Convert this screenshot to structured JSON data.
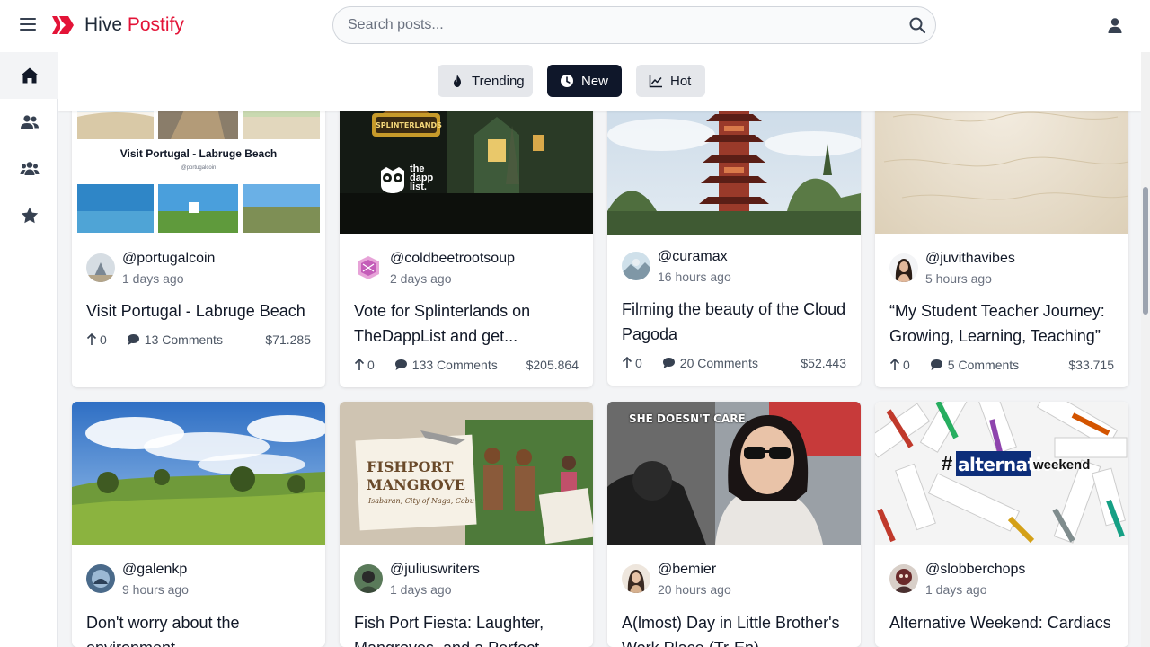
{
  "app": {
    "name_part1": "Hive",
    "name_part2": "Postify",
    "brand_color": "#e31337"
  },
  "search": {
    "placeholder": "Search posts..."
  },
  "filters": [
    {
      "label": "Trending",
      "icon": "flame-icon",
      "active": false
    },
    {
      "label": "New",
      "icon": "clock-icon",
      "active": true
    },
    {
      "label": "Hot",
      "icon": "chart-line-icon",
      "active": false
    }
  ],
  "sidebar": {
    "items": [
      {
        "icon": "home-icon",
        "active": true
      },
      {
        "icon": "users-icon",
        "active": false
      },
      {
        "icon": "communities-icon",
        "active": false
      },
      {
        "icon": "star-icon",
        "active": false
      }
    ]
  },
  "posts": [
    {
      "author": "@portugalcoin",
      "time": "1 days ago",
      "title": "Visit Portugal - Labruge Beach",
      "votes": "0",
      "comments": "13 Comments",
      "payout": "$71.285",
      "thumb_caption": "Visit Portugal - Labruge Beach",
      "thumb_subcaption": "@portugalcoin"
    },
    {
      "author": "@coldbeetrootsoup",
      "time": "2 days ago",
      "title": "Vote for Splinterlands on TheDappList and get...",
      "votes": "0",
      "comments": "133 Comments",
      "payout": "$205.864",
      "thumb_brand": "SPLINTERLANDS",
      "thumb_logo_line1": "the",
      "thumb_logo_line2": "dapp",
      "thumb_logo_line3": "list."
    },
    {
      "author": "@curamax",
      "time": "16 hours ago",
      "title": "Filming the beauty of the Cloud Pagoda",
      "votes": "0",
      "comments": "20 Comments",
      "payout": "$52.443"
    },
    {
      "author": "@juvithavibes",
      "time": "5 hours ago",
      "title": "“My Student Teacher Journey: Growing, Learning, Teaching”",
      "votes": "0",
      "comments": "5 Comments",
      "payout": "$33.715"
    },
    {
      "author": "@galenkp",
      "time": "9 hours ago",
      "title": "Don't worry about the environment"
    },
    {
      "author": "@juliuswriters",
      "time": "1 days ago",
      "title": "Fish Port Fiesta: Laughter, Mangroves, and a Perfect...",
      "thumb_line1": "FISHPORT",
      "thumb_line2": "MANGROVE",
      "thumb_line3": "Isabaran, City of Naga, Cebu"
    },
    {
      "author": "@bemier",
      "time": "20 hours ago",
      "title": "A(lmost) Day in Little Brother's Work Place (Tr-En)",
      "thumb_overlay": "SHE DOESN'T CARE"
    },
    {
      "author": "@slobberchops",
      "time": "1 days ago",
      "title": "Alternative Weekend: Cardiacs",
      "thumb_hash": "#",
      "thumb_word": "alternative",
      "thumb_word2": "weekend"
    }
  ]
}
